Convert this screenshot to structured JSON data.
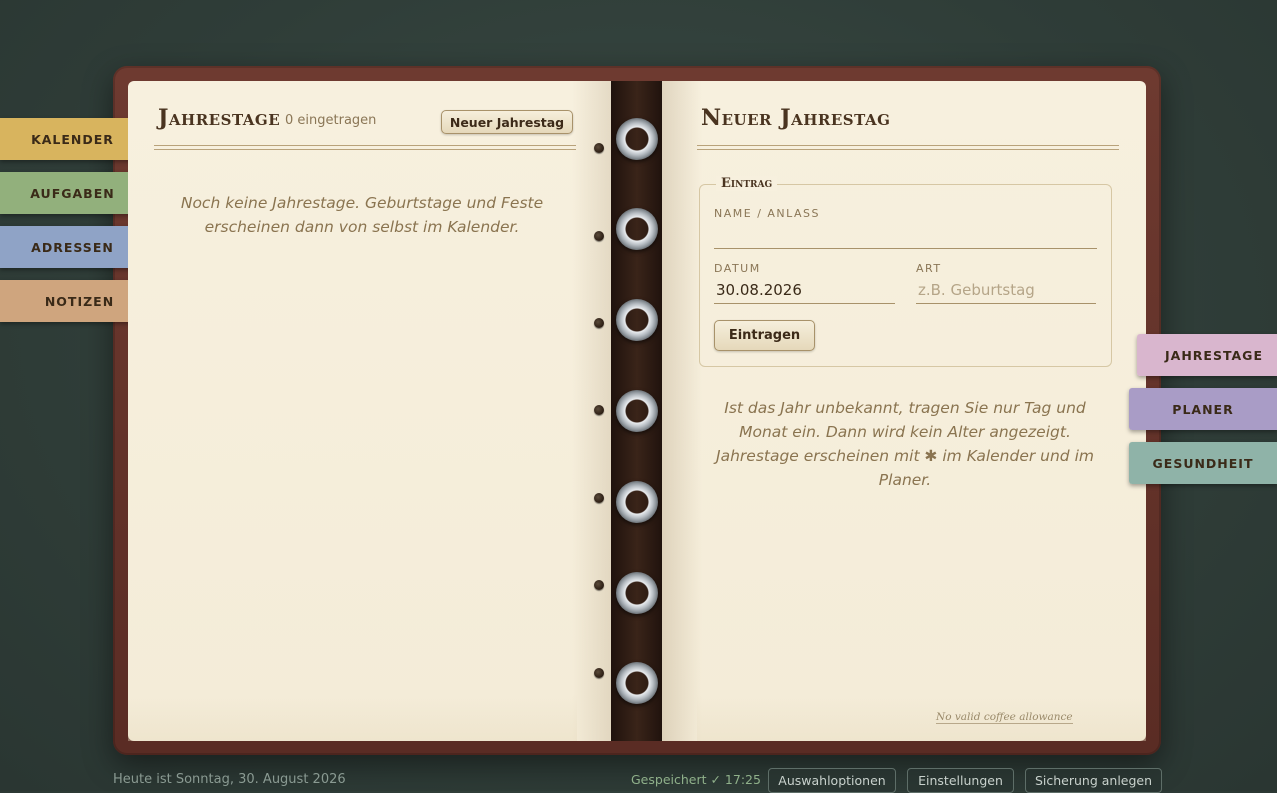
{
  "tabs_left": [
    {
      "label": "KALENDER",
      "color": "#d8b45e"
    },
    {
      "label": "AUFGABEN",
      "color": "#92b07c"
    },
    {
      "label": "ADRESSEN",
      "color": "#8fa3c6"
    },
    {
      "label": "NOTIZEN",
      "color": "#cfa57e"
    }
  ],
  "tabs_right": [
    {
      "label": "JAHRESTAGE",
      "color": "#d9b6ce",
      "active": true
    },
    {
      "label": "PLANER",
      "color": "#a99cc6"
    },
    {
      "label": "GESUNDHEIT",
      "color": "#8fb3a8"
    }
  ],
  "left_page": {
    "title": "Jahrestage",
    "count": "0 eingetragen",
    "new_button": "Neuer Jahrestag",
    "empty_note": "Noch keine Jahrestage. Geburtstage und Feste erscheinen dann von selbst im Kalender."
  },
  "right_page": {
    "title": "Neuer Jahrestag",
    "fieldset_legend": "Eintrag",
    "name_label": "NAME / ANLASS",
    "name_value": "",
    "date_label": "DATUM",
    "date_value": "30.08.2026",
    "type_label": "ART",
    "type_placeholder": "z.B. Geburtstag",
    "submit_button": "Eintragen",
    "help_note": "Ist das Jahr unbekannt, tragen Sie nur Tag und Monat ein. Dann wird kein Alter angezeigt. Jahrestage erscheinen mit ✱ im Kalender und im Planer.",
    "corner_link": "No valid coffee allowance"
  },
  "footer": {
    "today": "Heute ist Sonntag, 30. August 2026",
    "saved": "Gespeichert ✓ 17:25",
    "buttons": [
      "Auswahloptionen",
      "Einstellungen",
      "Sicherung anlegen"
    ]
  }
}
